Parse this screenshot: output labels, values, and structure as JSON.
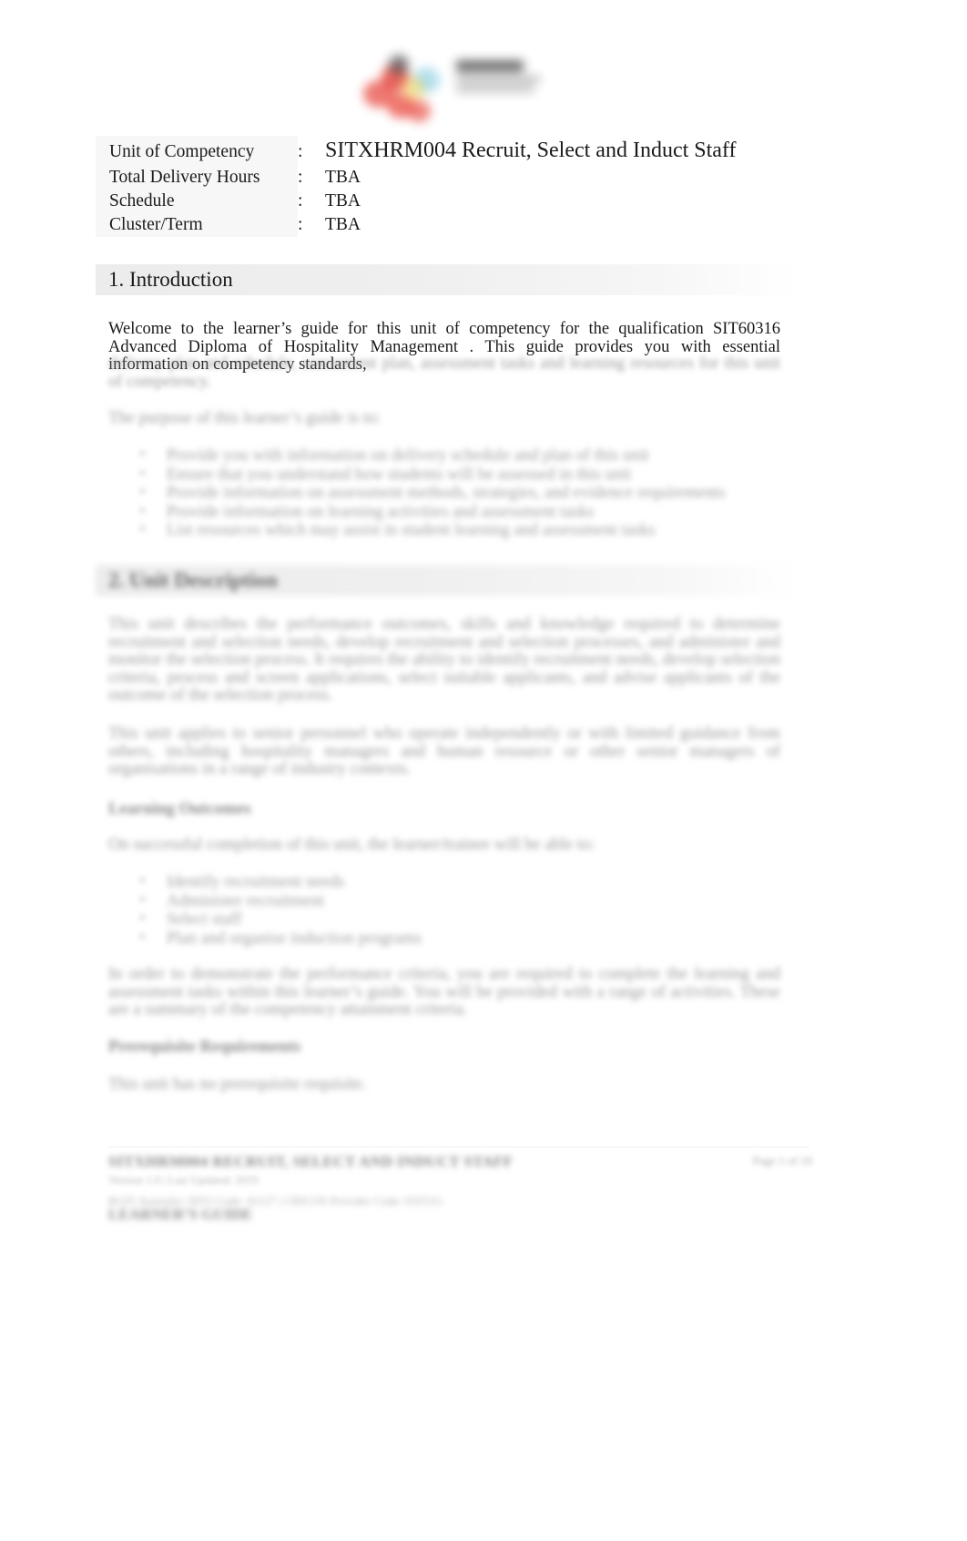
{
  "document": {
    "type": "learner-guide-page",
    "page_background": "#ffffff"
  },
  "logo": {
    "name": "rgit-australia-logo",
    "alt_text": "RGIT"
  },
  "info_table": {
    "rows": [
      {
        "label": "Unit of Competency",
        "separator": ":",
        "value": "SITXHRM004 Recruit, Select and Induct Staff"
      },
      {
        "label": "Total Delivery Hours",
        "separator": ":",
        "value": "TBA"
      },
      {
        "label": "Schedule",
        "separator": ":",
        "value": "TBA"
      },
      {
        "label": "Cluster/Term",
        "separator": ":",
        "value": "TBA"
      }
    ]
  },
  "sections": {
    "introduction": {
      "heading": "1. Introduction",
      "paragraph_visible_lead": "Welcome to the learner’s guide for this unit of competency for the qualification   SIT60316 Advanced Diploma of Hospitality Management . This guide provides you with essential information on competency standards,",
      "paragraph_blurred_tail": "delivery plan and schedule, assessment plan, assessment tasks and learning resources for this unit of competency.",
      "purpose_lead": "The purpose of this learner’s guide is to:",
      "purpose_items": [
        "Provide you with information on delivery schedule and plan of this unit",
        "Ensure that you understand how students will be assessed in this unit",
        "Provide information on assessment methods, strategies, and evidence requirements",
        "Provide information on learning activities and assessment tasks",
        "List resources which may assist in student learning and assessment tasks"
      ]
    },
    "unit_description": {
      "heading": "2. Unit Description",
      "paragraph_1": "This unit describes the performance outcomes, skills and knowledge required to determine recruitment and selection needs, develop recruitment and selection processes, and administer and monitor the selection process. It requires the ability to identify recruitment needs, develop selection criteria, process and screen applications, select suitable applicants, and advise applicants of the outcome of the selection process.",
      "paragraph_2": "This unit applies to senior personnel who operate independently or with limited guidance from others, including hospitality managers and human resource or other senior managers of organisations in a range of industry contexts.",
      "outcomes_heading": "Learning Outcomes",
      "outcomes_lead": "On successful completion of this unit, the learner/trainee will be able to:",
      "outcomes_items": [
        "Identify recruitment needs",
        "Administer recruitment",
        "Select staff",
        "Plan and organise induction programs"
      ],
      "assessment_note": "In order to demonstrate the performance criteria, you are required to complete the learning and assessment tasks within this learner’s guide. You will be provided with a range of activities. These are a summary of the competency attainment criteria.",
      "prerequisite_heading": "Prerequisite Requirements",
      "prerequisite_body": "This unit has no prerequisite requisite."
    }
  },
  "footer": {
    "line_title": "SITXHRM004 RECRUIT, SELECT AND INDUCT STAFF",
    "line_sub": "Version 1.0 | Last Updated: 2019",
    "line_mid": "RGIT Australia | RTO Code: 41127 | CRICOS Provider Code: 03551G",
    "line_title2": "LEARNER’S GUIDE",
    "page_number": "Page 1 of 10"
  }
}
